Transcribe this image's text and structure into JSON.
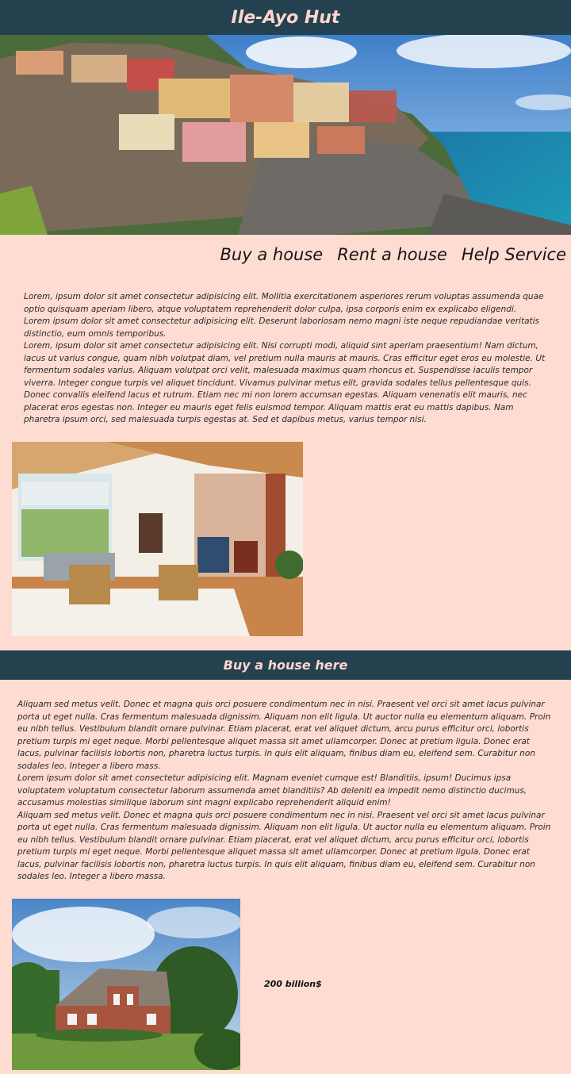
{
  "header": {
    "title": "Ile-Ayo Hut"
  },
  "nav": {
    "buy": "Buy a house",
    "rent": "Rent a house",
    "help": "Help Service"
  },
  "intro": {
    "lines": [
      "Lorem, ipsum dolor sit amet consectetur adipisicing elit. Mollitia exercitationem asperiores rerum voluptas assumenda quae optio quisquam aperiam libero, atque voluptatem reprehenderit dolor culpa, ipsa corporis enim ex explicabo eligendi.",
      "Lorem ipsum dolor sit amet consectetur adipisicing elit. Deserunt laboriosam nemo magni iste neque repudiandae veritatis distinctio, eum omnis temporibus.",
      "Lorem, ipsum dolor sit amet consectetur adipisicing elit. Nisi corrupti modi, aliquid sint aperiam praesentium! Nam dictum, lacus ut varius congue, quam nibh volutpat diam, vel pretium nulla mauris at mauris. Cras efficitur eget eros eu molestie. Ut fermentum sodales varius. Aliquam volutpat orci velit, malesuada maximus quam rhoncus et. Suspendisse iaculis tempor viverra. Integer congue turpis vel aliquet tincidunt. Vivamus pulvinar metus elit, gravida sodales tellus pellentesque quis. Donec convallis eleifend lacus et rutrum. Etiam nec mi non lorem accumsan egestas. Aliquam venenatis elit mauris, nec placerat eros egestas non. Integer eu mauris eget felis euismod tempor. Aliquam mattis erat eu mattis dapibus. Nam pharetra ipsum orci, sed malesuada turpis egestas at. Sed et dapibus metus, varius tempor nisi."
    ]
  },
  "section": {
    "title": "Buy a house here",
    "lines": [
      "Aliquam sed metus velit. Donec et magna quis orci posuere condimentum nec in nisi. Praesent vel orci sit amet lacus pulvinar porta ut eget nulla. Cras fermentum malesuada dignissim. Aliquam non elit ligula. Ut auctor nulla eu elementum aliquam. Proin eu nibh tellus. Vestibulum blandit ornare pulvinar. Etiam placerat, erat vel aliquet dictum, arcu purus efficitur orci, lobortis pretium turpis mi eget neque. Morbi pellentesque aliquet massa sit amet ullamcorper. Donec at pretium ligula. Donec erat lacus, pulvinar facilisis lobortis non, pharetra luctus turpis. In quis elit aliquam, finibus diam eu, eleifend sem. Curabitur non sodales leo. Integer a libero mass.",
      "Lorem ipsum dolor sit amet consectetur adipisicing elit. Magnam eveniet cumque est! Blanditiis, ipsum! Ducimus ipsa voluptatem voluptatum consectetur laborum assumenda amet blanditiis? Ab deleniti ea impedit nemo distinctio ducimus, accusamus molestias similique laborum sint magni explicabo reprehenderit aliquid enim!",
      "Aliquam sed metus velit. Donec et magna quis orci posuere condimentum nec in nisi. Praesent vel orci sit amet lacus pulvinar porta ut eget nulla. Cras fermentum malesuada dignissim. Aliquam non elit ligula. Ut auctor nulla eu elementum aliquam. Proin eu nibh tellus. Vestibulum blandit ornare pulvinar. Etiam placerat, erat vel aliquet dictum, arcu purus efficitur orci, lobortis pretium turpis mi eget neque. Morbi pellentesque aliquet massa sit amet ullamcorper. Donec at pretium ligula. Donec erat lacus, pulvinar facilisis lobortis non, pharetra luctus turpis. In quis elit aliquam, finibus diam eu, eleifend sem. Curabitur non sodales leo. Integer a libero massa."
    ],
    "price": "200 billion$"
  },
  "colors": {
    "page_bg": "#ffdcd2",
    "bar_bg": "#24414f",
    "bar_text": "#ffd6ce"
  }
}
